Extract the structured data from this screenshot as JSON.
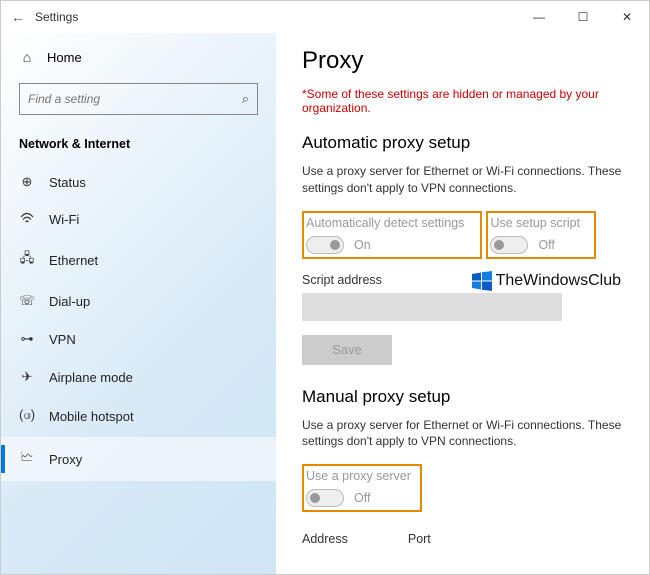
{
  "titlebar": {
    "title": "Settings"
  },
  "sidebar": {
    "home": "Home",
    "search_placeholder": "Find a setting",
    "section": "Network & Internet",
    "items": [
      {
        "label": "Status"
      },
      {
        "label": "Wi-Fi"
      },
      {
        "label": "Ethernet"
      },
      {
        "label": "Dial-up"
      },
      {
        "label": "VPN"
      },
      {
        "label": "Airplane mode"
      },
      {
        "label": "Mobile hotspot"
      },
      {
        "label": "Proxy"
      }
    ]
  },
  "content": {
    "title": "Proxy",
    "warning": "*Some of these settings are hidden or managed by your organization.",
    "auto": {
      "heading": "Automatic proxy setup",
      "desc": "Use a proxy server for Ethernet or Wi-Fi connections. These settings don't apply to VPN connections.",
      "detect_label": "Automatically detect settings",
      "detect_state": "On",
      "script_label": "Use setup script",
      "script_state": "Off",
      "script_addr_label": "Script address",
      "save_label": "Save"
    },
    "manual": {
      "heading": "Manual proxy setup",
      "desc": "Use a proxy server for Ethernet or Wi-Fi connections. These settings don't apply to VPN connections.",
      "use_label": "Use a proxy server",
      "use_state": "Off",
      "address_label": "Address",
      "port_label": "Port"
    }
  },
  "watermark": "TheWindowsClub"
}
